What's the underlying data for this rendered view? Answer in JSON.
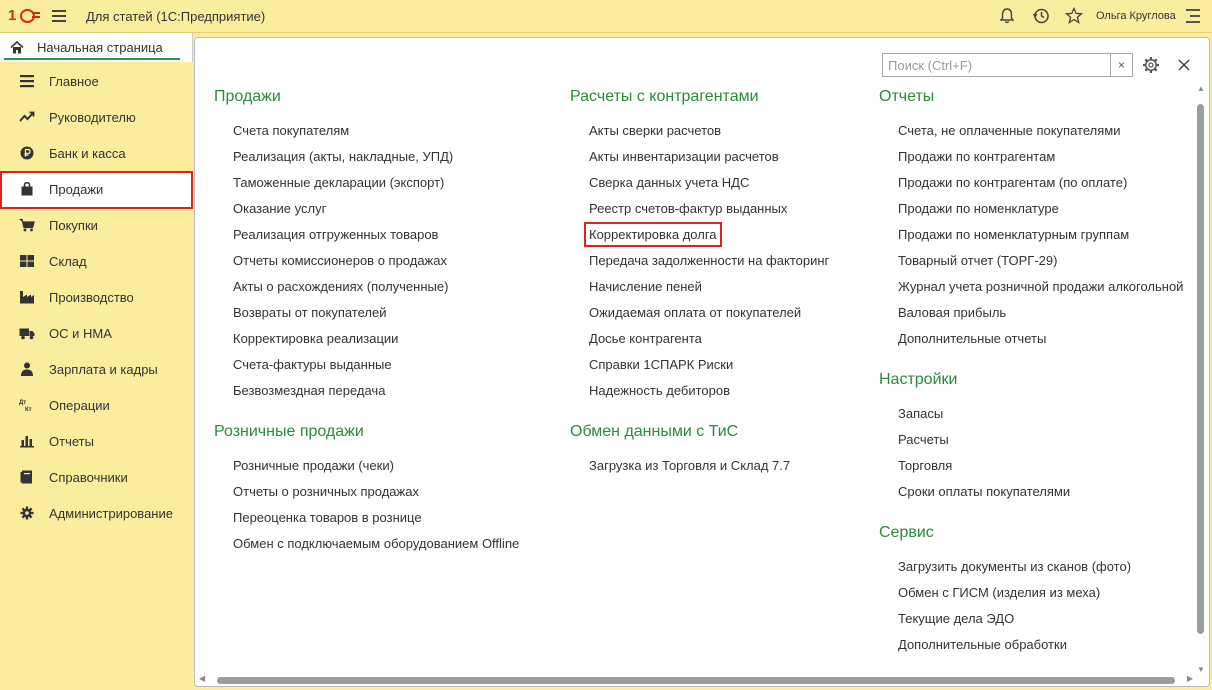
{
  "app": {
    "title": "Для статей  (1С:Предприятие)",
    "logo_text": "1С",
    "user": "Ольга Круглова"
  },
  "home_tab": {
    "label": "Начальная страница"
  },
  "sidebar": {
    "items": [
      {
        "label": "Главное",
        "icon": "list-icon"
      },
      {
        "label": "Руководителю",
        "icon": "trend-icon"
      },
      {
        "label": "Банк и касса",
        "icon": "ruble-icon"
      },
      {
        "label": "Продажи",
        "icon": "shopping-bag-icon",
        "active": true
      },
      {
        "label": "Покупки",
        "icon": "cart-icon"
      },
      {
        "label": "Склад",
        "icon": "warehouse-icon"
      },
      {
        "label": "Производство",
        "icon": "factory-icon"
      },
      {
        "label": "ОС и НМА",
        "icon": "truck-icon"
      },
      {
        "label": "Зарплата и кадры",
        "icon": "person-icon"
      },
      {
        "label": "Операции",
        "icon": "dt-kt-icon"
      },
      {
        "label": "Отчеты",
        "icon": "bar-chart-icon"
      },
      {
        "label": "Справочники",
        "icon": "book-icon"
      },
      {
        "label": "Администрирование",
        "icon": "gear-icon"
      }
    ],
    "dt_label": "Дт",
    "kt_label": "Кт"
  },
  "search": {
    "placeholder": "Поиск (Ctrl+F)",
    "clear": "×"
  },
  "sections": {
    "sales": {
      "title": "Продажи",
      "links": [
        "Счета покупателям",
        "Реализация (акты, накладные, УПД)",
        "Таможенные декларации (экспорт)",
        "Оказание услуг",
        "Реализация отгруженных товаров",
        "Отчеты комиссионеров о продажах",
        "Акты о расхождениях (полученные)",
        "Возвраты от покупателей",
        "Корректировка реализации",
        "Счета-фактуры выданные",
        "Безвозмездная передача"
      ]
    },
    "retail": {
      "title": "Розничные продажи",
      "links": [
        "Розничные продажи (чеки)",
        "Отчеты о розничных продажах",
        "Переоценка товаров в рознице",
        "Обмен с подключаемым оборудованием Offline"
      ]
    },
    "settlements": {
      "title": "Расчеты с контрагентами",
      "links": [
        "Акты сверки расчетов",
        "Акты инвентаризации расчетов",
        "Сверка данных учета НДС",
        "Реестр счетов-фактур выданных",
        "Корректировка долга",
        "Передача задолженности на факторинг",
        "Начисление пеней",
        "Ожидаемая оплата от покупателей",
        "Досье контрагента",
        "Справки 1СПАРК Риски",
        "Надежность дебиторов"
      ],
      "highlighted_index": 4
    },
    "exchange": {
      "title": "Обмен данными с ТиС",
      "links": [
        "Загрузка из Торговля и Склад 7.7"
      ]
    },
    "reports": {
      "title": "Отчеты",
      "links": [
        "Счета, не оплаченные покупателями",
        "Продажи по контрагентам",
        "Продажи по контрагентам (по оплате)",
        "Продажи по номенклатуре",
        "Продажи по номенклатурным группам",
        "Товарный отчет (ТОРГ-29)",
        "Журнал учета розничной продажи алкогольной",
        "Валовая прибыль",
        "Дополнительные отчеты"
      ]
    },
    "settings": {
      "title": "Настройки",
      "links": [
        "Запасы",
        "Расчеты",
        "Торговля",
        "Сроки оплаты покупателями"
      ]
    },
    "service": {
      "title": "Сервис",
      "links": [
        "Загрузить документы из сканов (фото)",
        "Обмен с ГИСМ (изделия из меха)",
        "Текущие дела ЭДО",
        "Дополнительные обработки"
      ]
    }
  },
  "colors": {
    "sidebar_bg": "#fbed9e",
    "section_title": "#2a8a3e",
    "highlight": "#d9261c"
  }
}
